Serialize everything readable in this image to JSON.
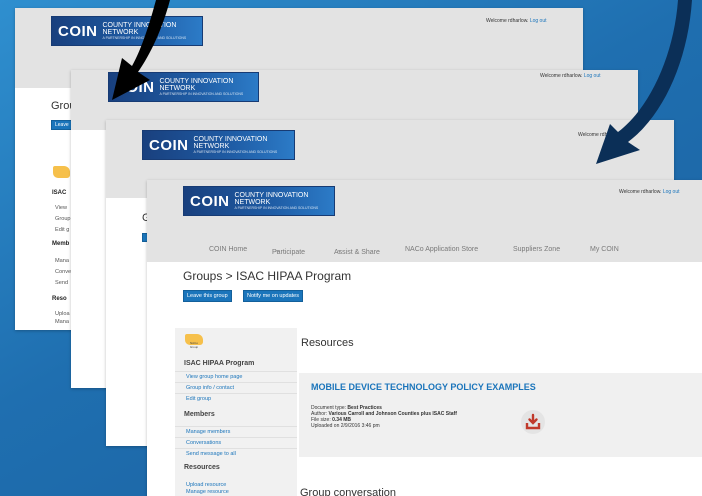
{
  "logo": {
    "brand": "COIN",
    "name": "COUNTY INNOVATION NETWORK",
    "tagline": "A PARTNERSHIP IN INNOVATION AND SOLUTIONS"
  },
  "header": {
    "welcome": "Welcome rdharlow.",
    "logout": "Log out"
  },
  "nav": {
    "items": [
      {
        "label": "COIN Home"
      },
      {
        "label": "Participate",
        "dropdown": true
      },
      {
        "label": "Assist & Share",
        "dropdown": true
      },
      {
        "label": "NACo Application Store"
      },
      {
        "label": "Suppliers Zone"
      },
      {
        "label": "My COIN"
      }
    ]
  },
  "page": {
    "breadcrumb": "Groups > ISAC HIPAA Program",
    "leave_button": "Leave this group",
    "notify_button": "Notify me on updates"
  },
  "sidebar": {
    "flag_caption": "NACo Group",
    "group_title": "ISAC HIPAA Program",
    "links_group": [
      "View group home page",
      "Group info / contact",
      "Edit group"
    ],
    "members_title": "Members",
    "links_members": [
      "Manage members",
      "Conversations",
      "Send message to all"
    ],
    "resources_title": "Resources",
    "links_resources": [
      "Upload resource",
      "Manage resource"
    ]
  },
  "resources": {
    "heading": "Resources",
    "item": {
      "title": "MOBILE DEVICE TECHNOLOGY POLICY EXAMPLES",
      "doc_type_label": "Document type:",
      "doc_type": "Best Practices",
      "author_label": "Author:",
      "author": "Various Carroll and Johnson Counties plus ISAC Staff",
      "size_label": "File size:",
      "size": "0.34 MB",
      "uploaded": "Uploaded on 2/9/2016 3:46 pm"
    },
    "download_icon": "download-icon"
  },
  "conversation": {
    "heading": "Group conversation"
  },
  "layer1": {
    "breadcrumb": "Grou",
    "leave_button": "Leave",
    "group_title": "ISAC",
    "links_group": [
      "View",
      "Group",
      "Edit g"
    ],
    "members_title": "Memb",
    "links_members": [
      "Mana",
      "Conve",
      "Send"
    ],
    "resources_title": "Reso",
    "links_resources": [
      "Uploa",
      "Mana"
    ]
  },
  "layer2": {
    "welcome": "Welcome rdharlow.",
    "logout": "Log out"
  },
  "layer3": {
    "welcome": "Welcome rdharl",
    "crumb_fragment": "G"
  },
  "colors": {
    "background": "#1f6fb0",
    "accent": "#1b75bb",
    "arrow": "#000000",
    "arrow2": "#0b2f57",
    "download": "#c0392b"
  }
}
